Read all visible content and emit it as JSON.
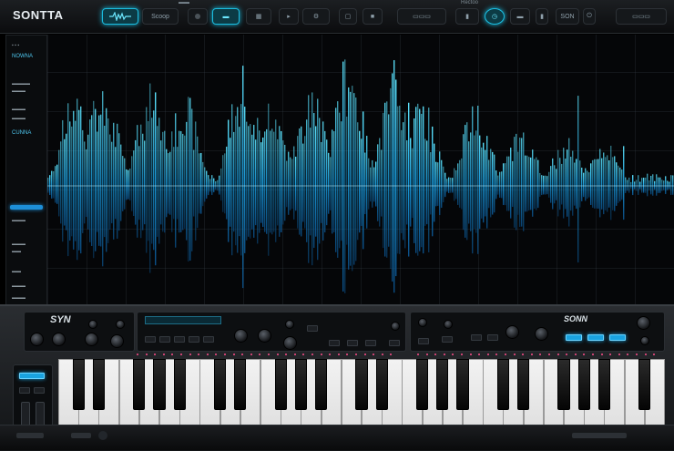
{
  "app": {
    "brand": "SONTTA"
  },
  "topbar": {
    "buttons": [
      {
        "label": "Scoop",
        "icon": "waveform-icon"
      },
      {
        "label": "",
        "icon": "record-icon"
      },
      {
        "label": "",
        "icon": "list-icon"
      },
      {
        "label": "",
        "icon": "grid-icon"
      },
      {
        "label": "",
        "icon": "play-icon"
      },
      {
        "label": "",
        "icon": "settings-icon"
      },
      {
        "label": "",
        "icon": "loop-icon"
      },
      {
        "label": "",
        "icon": "mic-icon"
      },
      {
        "label": "SON",
        "icon": "volume-icon"
      },
      {
        "label": "",
        "icon": "power-icon"
      }
    ],
    "top_labels": [
      "Rectoo"
    ]
  },
  "sidebar": {
    "items": [
      "NOWNA",
      "CUNNA"
    ]
  },
  "synth": {
    "left_logo": "SYN",
    "right_logo": "SONN"
  },
  "colors": {
    "accent": "#1bbde0",
    "wave": "#22c9ff",
    "background": "#050608"
  }
}
